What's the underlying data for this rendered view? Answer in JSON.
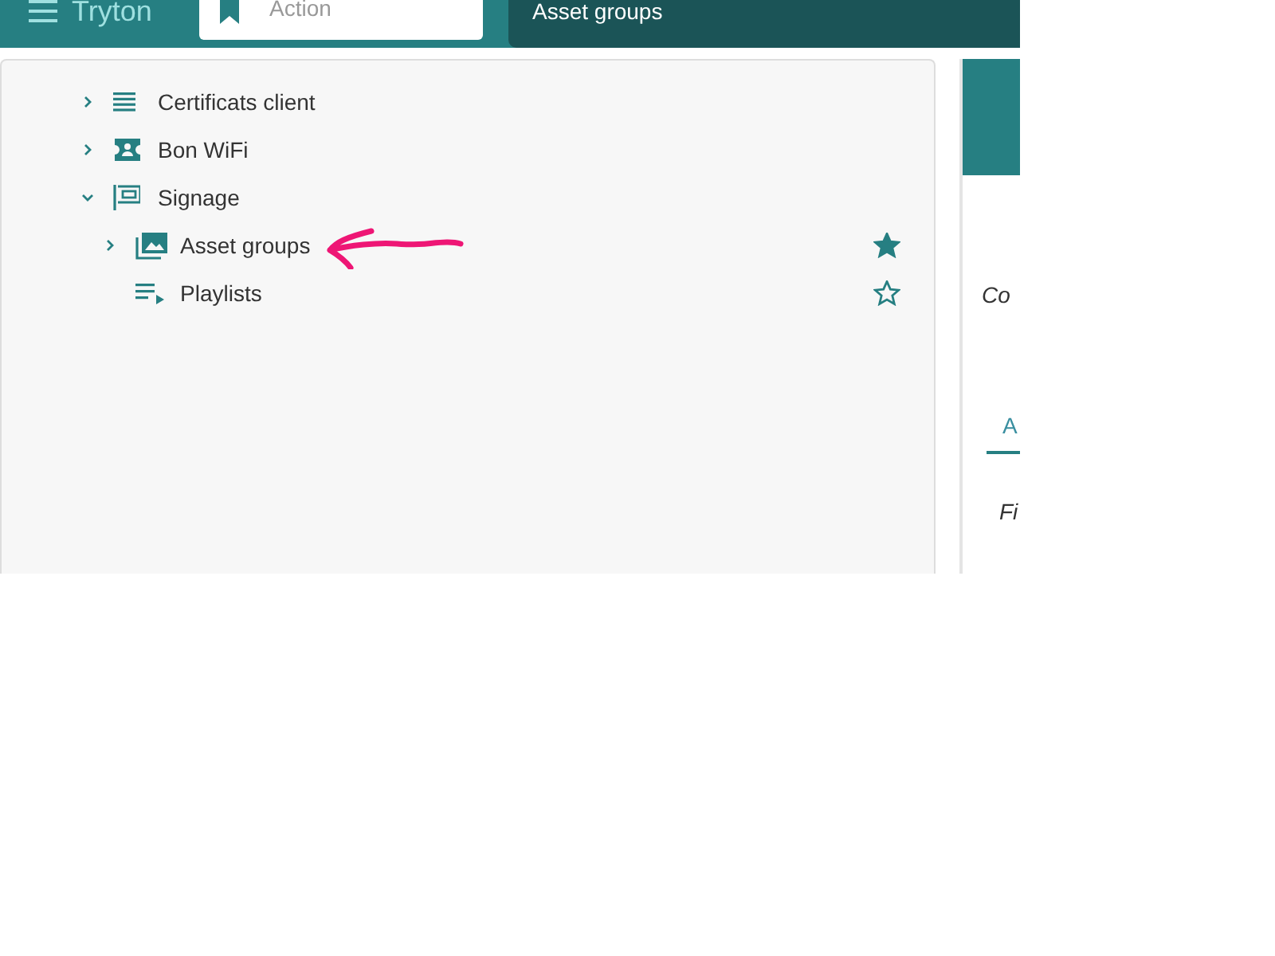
{
  "header": {
    "app_title": "Tryton",
    "action_field": {
      "placeholder": "Action"
    },
    "tab_title": "Asset groups"
  },
  "menu_tree": [
    {
      "label": "Certificats client",
      "kind": "list",
      "expanded": false
    },
    {
      "label": "Bon WiFi",
      "kind": "card",
      "expanded": false
    },
    {
      "label": "Signage",
      "kind": "signage",
      "expanded": true,
      "children": [
        {
          "label": "Asset groups",
          "kind": "gallery",
          "expanded": false,
          "favorite": true
        },
        {
          "label": "Playlists",
          "kind": "playlist",
          "favorite": false
        }
      ]
    }
  ],
  "right_panel": {
    "field_label": "Co",
    "tab": {
      "label": "A",
      "selected": true
    },
    "field_label_2": "Fi"
  }
}
